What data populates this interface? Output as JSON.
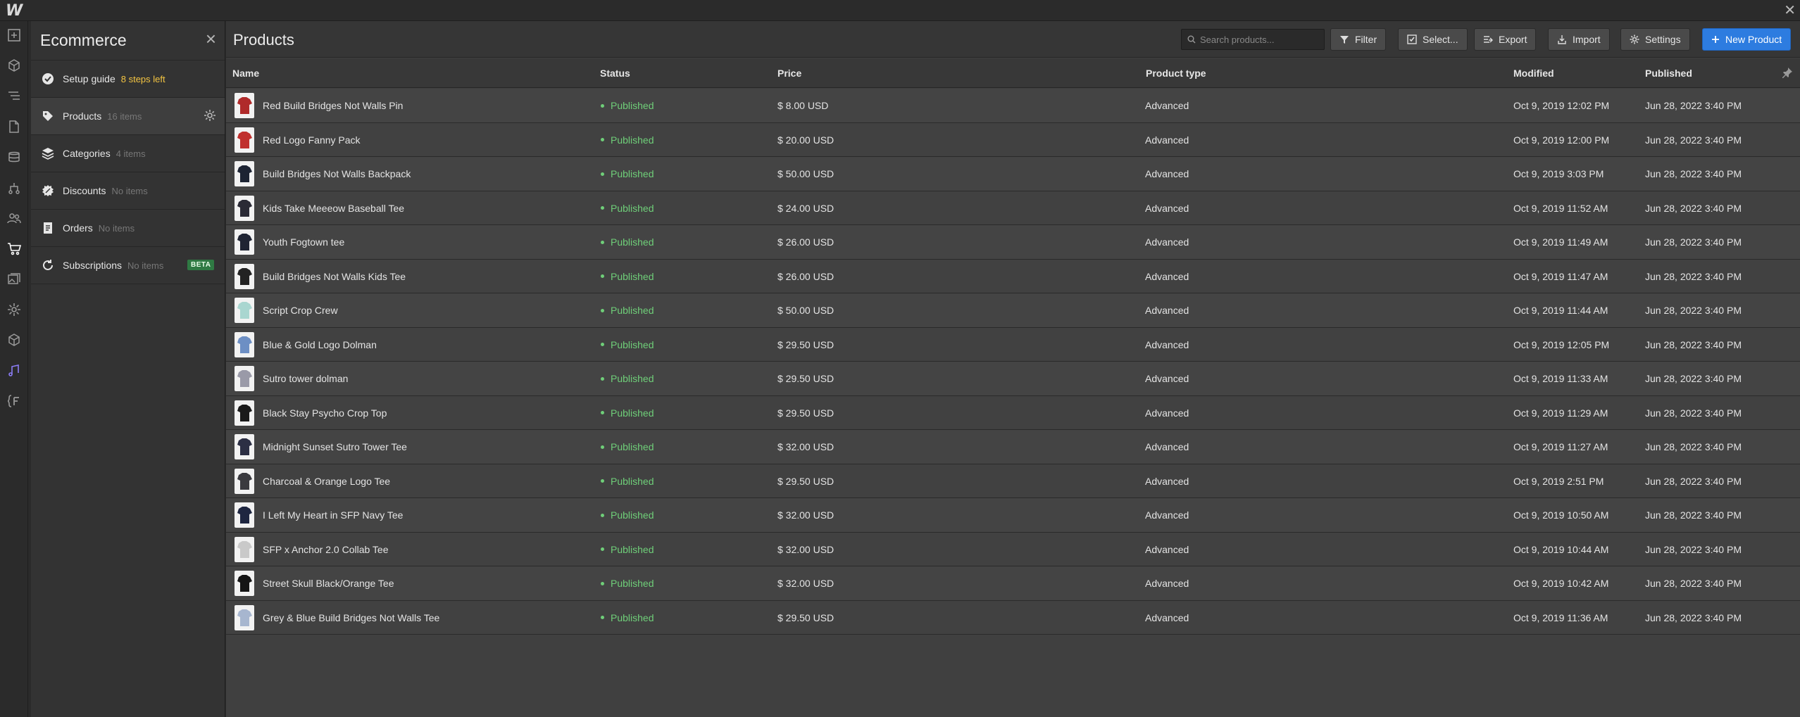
{
  "app": {
    "logo": "W"
  },
  "panel": {
    "title": "Ecommerce",
    "items": [
      {
        "label": "Setup guide",
        "count": "8 steps left",
        "icon": "check-circle-icon"
      },
      {
        "label": "Products",
        "count": "16 items",
        "icon": "tag-icon"
      },
      {
        "label": "Categories",
        "count": "4 items",
        "icon": "layers-icon"
      },
      {
        "label": "Discounts",
        "count": "No items",
        "icon": "discount-badge-icon"
      },
      {
        "label": "Orders",
        "count": "No items",
        "icon": "receipt-icon"
      },
      {
        "label": "Subscriptions",
        "count": "No items",
        "icon": "refresh-icon",
        "badge": "BETA"
      }
    ]
  },
  "main": {
    "title": "Products",
    "search_placeholder": "Search products...",
    "buttons": {
      "filter": "Filter",
      "select": "Select...",
      "export": "Export",
      "import": "Import",
      "settings": "Settings",
      "new_product": "New Product"
    }
  },
  "table": {
    "columns": [
      "Name",
      "Status",
      "Price",
      "Product type",
      "Modified",
      "Published"
    ],
    "rows": [
      {
        "name": "Red Build Bridges Not Walls Pin",
        "status": "Published",
        "price": "$ 8.00 USD",
        "type": "Advanced",
        "modified": "Oct 9, 2019 12:02 PM",
        "published": "Jun 28, 2022 3:40 PM",
        "thumb": "#b02a2a"
      },
      {
        "name": "Red Logo Fanny Pack",
        "status": "Published",
        "price": "$ 20.00 USD",
        "type": "Advanced",
        "modified": "Oct 9, 2019 12:00 PM",
        "published": "Jun 28, 2022 3:40 PM",
        "thumb": "#c0302e"
      },
      {
        "name": "Build Bridges Not Walls Backpack",
        "status": "Published",
        "price": "$ 50.00 USD",
        "type": "Advanced",
        "modified": "Oct 9, 2019 3:03 PM",
        "published": "Jun 28, 2022 3:40 PM",
        "thumb": "#1d2433"
      },
      {
        "name": "Kids Take Meeeow Baseball Tee",
        "status": "Published",
        "price": "$ 24.00 USD",
        "type": "Advanced",
        "modified": "Oct 9, 2019 11:52 AM",
        "published": "Jun 28, 2022 3:40 PM",
        "thumb": "#2a2a35"
      },
      {
        "name": "Youth Fogtown tee",
        "status": "Published",
        "price": "$ 26.00 USD",
        "type": "Advanced",
        "modified": "Oct 9, 2019 11:49 AM",
        "published": "Jun 28, 2022 3:40 PM",
        "thumb": "#1f2433"
      },
      {
        "name": "Build Bridges Not Walls Kids Tee",
        "status": "Published",
        "price": "$ 26.00 USD",
        "type": "Advanced",
        "modified": "Oct 9, 2019 11:47 AM",
        "published": "Jun 28, 2022 3:40 PM",
        "thumb": "#232323"
      },
      {
        "name": "Script Crop Crew",
        "status": "Published",
        "price": "$ 50.00 USD",
        "type": "Advanced",
        "modified": "Oct 9, 2019 11:44 AM",
        "published": "Jun 28, 2022 3:40 PM",
        "thumb": "#a9d6d0"
      },
      {
        "name": "Blue & Gold Logo Dolman",
        "status": "Published",
        "price": "$ 29.50 USD",
        "type": "Advanced",
        "modified": "Oct 9, 2019 12:05 PM",
        "published": "Jun 28, 2022 3:40 PM",
        "thumb": "#6d8fc4"
      },
      {
        "name": "Sutro tower dolman",
        "status": "Published",
        "price": "$ 29.50 USD",
        "type": "Advanced",
        "modified": "Oct 9, 2019 11:33 AM",
        "published": "Jun 28, 2022 3:40 PM",
        "thumb": "#9a9aa8"
      },
      {
        "name": "Black Stay Psycho Crop Top",
        "status": "Published",
        "price": "$ 29.50 USD",
        "type": "Advanced",
        "modified": "Oct 9, 2019 11:29 AM",
        "published": "Jun 28, 2022 3:40 PM",
        "thumb": "#1a1a1a"
      },
      {
        "name": "Midnight Sunset Sutro Tower Tee",
        "status": "Published",
        "price": "$ 32.00 USD",
        "type": "Advanced",
        "modified": "Oct 9, 2019 11:27 AM",
        "published": "Jun 28, 2022 3:40 PM",
        "thumb": "#2c2f44"
      },
      {
        "name": "Charcoal & Orange Logo Tee",
        "status": "Published",
        "price": "$ 29.50 USD",
        "type": "Advanced",
        "modified": "Oct 9, 2019 2:51 PM",
        "published": "Jun 28, 2022 3:40 PM",
        "thumb": "#3a3a3f"
      },
      {
        "name": "I Left My Heart in SFP Navy Tee",
        "status": "Published",
        "price": "$ 32.00 USD",
        "type": "Advanced",
        "modified": "Oct 9, 2019 10:50 AM",
        "published": "Jun 28, 2022 3:40 PM",
        "thumb": "#1e2640"
      },
      {
        "name": "SFP x Anchor 2.0 Collab Tee",
        "status": "Published",
        "price": "$ 32.00 USD",
        "type": "Advanced",
        "modified": "Oct 9, 2019 10:44 AM",
        "published": "Jun 28, 2022 3:40 PM",
        "thumb": "#c9c9c9"
      },
      {
        "name": "Street Skull Black/Orange Tee",
        "status": "Published",
        "price": "$ 32.00 USD",
        "type": "Advanced",
        "modified": "Oct 9, 2019 10:42 AM",
        "published": "Jun 28, 2022 3:40 PM",
        "thumb": "#151515"
      },
      {
        "name": "Grey & Blue Build Bridges Not Walls Tee",
        "status": "Published",
        "price": "$ 29.50 USD",
        "type": "Advanced",
        "modified": "Oct 9, 2019 11:36 AM",
        "published": "Jun 28, 2022 3:40 PM",
        "thumb": "#a7b6cf"
      }
    ]
  },
  "rail_icons": [
    "add-icon",
    "cube-icon",
    "navigator-icon",
    "pages-icon",
    "cms-icon",
    "logic-icon",
    "users-icon",
    "ecommerce-icon",
    "assets-icon",
    "settings-icon",
    "apps-icon",
    "audit-icon",
    "code-icon"
  ],
  "colors": {
    "accent": "#2d7ce0",
    "published": "#6fcf79",
    "steps_left": "#f4c542",
    "beta": "#2f7a43"
  }
}
